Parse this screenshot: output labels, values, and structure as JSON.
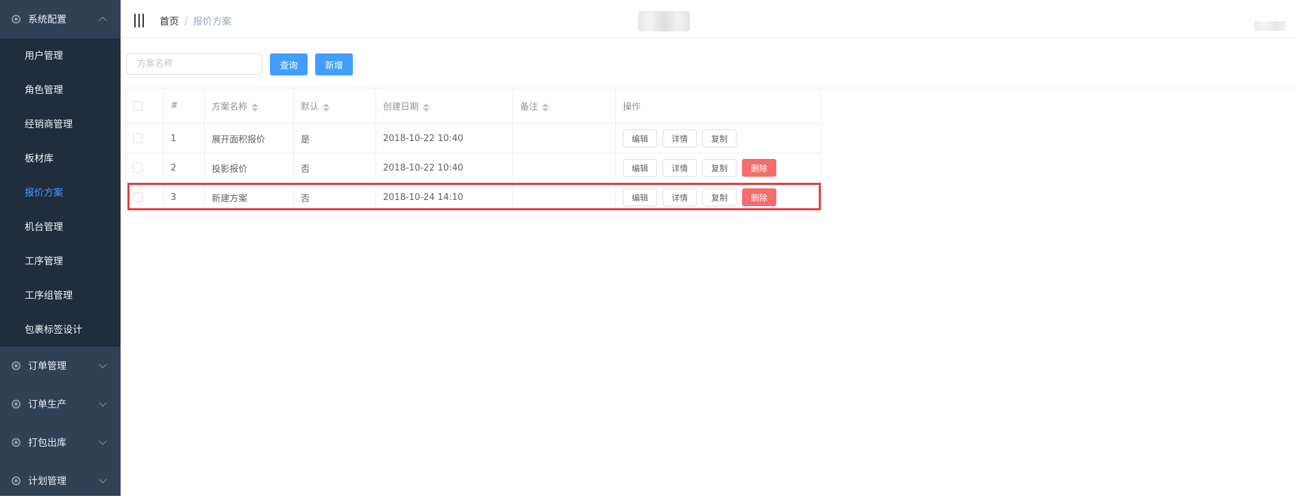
{
  "sidebar": {
    "top_group": {
      "label": "系统配置",
      "icon": "settings-gear-icon",
      "expanded": true
    },
    "sub_items": [
      {
        "label": "用户管理",
        "active": false
      },
      {
        "label": "角色管理",
        "active": false
      },
      {
        "label": "经销商管理",
        "active": false
      },
      {
        "label": "板材库",
        "active": false
      },
      {
        "label": "报价方案",
        "active": true
      },
      {
        "label": "机台管理",
        "active": false
      },
      {
        "label": "工序管理",
        "active": false
      },
      {
        "label": "工序组管理",
        "active": false
      },
      {
        "label": "包裹标签设计",
        "active": false
      }
    ],
    "groups": [
      {
        "label": "订单管理",
        "icon": "settings-gear-icon"
      },
      {
        "label": "订单生产",
        "icon": "settings-gear-icon"
      },
      {
        "label": "打包出库",
        "icon": "settings-gear-icon"
      },
      {
        "label": "计划管理",
        "icon": "settings-gear-icon"
      }
    ],
    "active_color": "#409eff",
    "bg_color": "#304156"
  },
  "header": {
    "breadcrumb_home": "首页",
    "breadcrumb_sep": "/",
    "breadcrumb_current": "报价方案"
  },
  "toolbar": {
    "search_placeholder": "方案名称",
    "search_value": "",
    "query_label": "查询",
    "add_label": "新增",
    "primary_color": "#409eff"
  },
  "table": {
    "columns": [
      "",
      "#",
      "方案名称",
      "默认",
      "创建日期",
      "备注",
      "操作"
    ],
    "rows": [
      {
        "index": "1",
        "name": "展开面积报价",
        "default": "是",
        "created": "2018-10-22 10:40",
        "remark": "",
        "actions": [
          "编辑",
          "详情",
          "复制"
        ]
      },
      {
        "index": "2",
        "name": "投影报价",
        "default": "否",
        "created": "2018-10-22 10:40",
        "remark": "",
        "actions": [
          "编辑",
          "详情",
          "复制",
          "删除"
        ]
      },
      {
        "index": "3",
        "name": "新建方案",
        "default": "否",
        "created": "2018-10-24 14:10",
        "remark": "",
        "actions": [
          "编辑",
          "详情",
          "复制",
          "删除"
        ]
      }
    ],
    "danger_color": "#f56c6c",
    "highlight_color": "#e8393f",
    "highlighted_row": 3
  }
}
